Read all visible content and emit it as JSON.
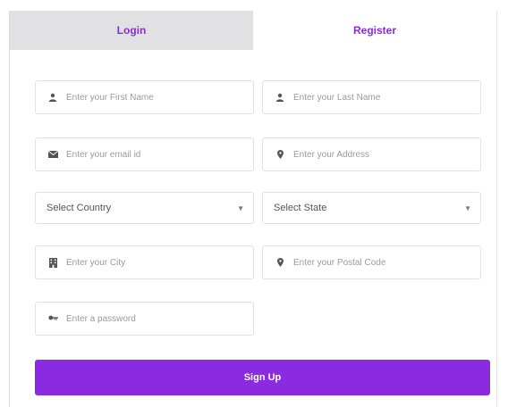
{
  "tabs": {
    "login": "Login",
    "register": "Register"
  },
  "form": {
    "first_name": {
      "placeholder": "Enter your First Name",
      "icon": "user-icon"
    },
    "last_name": {
      "placeholder": "Enter your Last Name",
      "icon": "user-icon"
    },
    "email": {
      "placeholder": "Enter your email id",
      "icon": "envelope-icon"
    },
    "address": {
      "placeholder": "Enter your Address",
      "icon": "map-marker-icon"
    },
    "country": {
      "selected": "Select Country"
    },
    "state": {
      "selected": "Select State"
    },
    "city": {
      "placeholder": "Enter your City",
      "icon": "building-icon"
    },
    "postal_code": {
      "placeholder": "Enter your Postal Code",
      "icon": "map-marker-icon"
    },
    "password": {
      "placeholder": "Enter a password",
      "icon": "key-icon"
    }
  },
  "submit_label": "Sign Up",
  "colors": {
    "accent": "#8a2be2",
    "tab_inactive_bg": "#e1e1e3",
    "field_border": "#e2e2e2"
  }
}
